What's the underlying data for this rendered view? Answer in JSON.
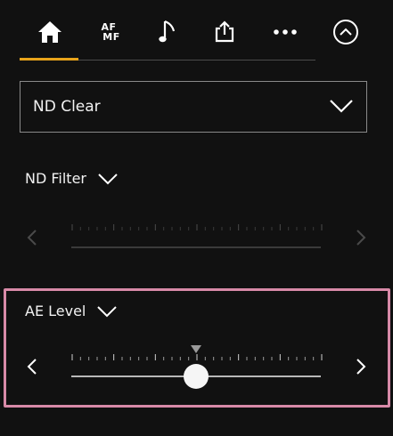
{
  "tabs": [
    {
      "name": "home",
      "icon": "home-icon",
      "active": true
    },
    {
      "name": "af-mf",
      "icon": "af-mf-icon",
      "top": "AF",
      "bottom": "MF",
      "active": false
    },
    {
      "name": "audio",
      "icon": "music-note-icon",
      "active": false
    },
    {
      "name": "share",
      "icon": "share-icon",
      "active": false
    },
    {
      "name": "more",
      "icon": "more-icon",
      "active": false
    },
    {
      "name": "collapse",
      "icon": "collapse-up-icon",
      "active": false
    }
  ],
  "nd_mode": {
    "value": "ND Clear"
  },
  "nd_filter": {
    "label": "ND Filter",
    "enabled": false
  },
  "ae_level": {
    "label": "AE Level",
    "value_fraction": 0.5,
    "highlighted": true
  },
  "colors": {
    "accent": "#e9a41b",
    "highlight": "#d88aa8",
    "background": "#111111"
  }
}
